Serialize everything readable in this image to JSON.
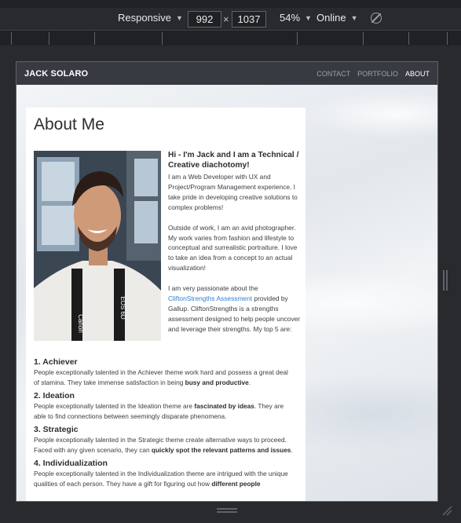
{
  "devtools": {
    "device": "Responsive",
    "width": "992",
    "times": "×",
    "height": "1037",
    "zoom": "54%",
    "network": "Online"
  },
  "site": {
    "brand": "JACK SOLARO",
    "nav": [
      "CONTACT",
      "PORTFOLIO",
      "ABOUT"
    ]
  },
  "about": {
    "title": "About Me",
    "heading": "Hi - I'm Jack and I am a Technical / Creative diachotomy!",
    "p1": "I am a Web Developer with UX and Project/Program Management experience. I take pride in developing creative solutions to complex problems!",
    "p2": "Outside of work, I am an avid photographer. My work varies from fashion and lifestyle to conceptual and surrealistic portraiture. I love to take an idea from a concept to an actual visualization!",
    "p3_pre": "I am very passionate about the",
    "p3_link": "CliftonStrengths Assessment",
    "p3_post": "provided by Gallup. CliftonStrengths is a strengths assessment designed to help people uncover and leverage their strengths. My top 5 are:"
  },
  "strengths": [
    {
      "title": "1. Achiever",
      "text": "People exceptionally talented in the Achiever theme work hard and possess a great deal of stamina. They take immense satisfaction in being",
      "bold": "busy and productive",
      "tail": "."
    },
    {
      "title": "2. Ideation",
      "text": "People exceptionally talented in the Ideation theme are",
      "bold": "fascinated by ideas",
      "tail": ". They are able to find connections between seemingly disparate phenomena."
    },
    {
      "title": "3. Strategic",
      "text": "People exceptionally talented in the Strategic theme create alternative ways to proceed. Faced with any given scenario, they can",
      "bold": "quickly spot the relevant patterns and issues",
      "tail": "."
    },
    {
      "title": "4. Individualization",
      "text": "People exceptionally talented in the Individualization theme are intrigued with the unique qualities of each person. They have a gift for figuring out how",
      "bold": "different people",
      "tail": ""
    }
  ],
  "camera_strap": {
    "left": "Canon",
    "right": "EOS 6D"
  }
}
